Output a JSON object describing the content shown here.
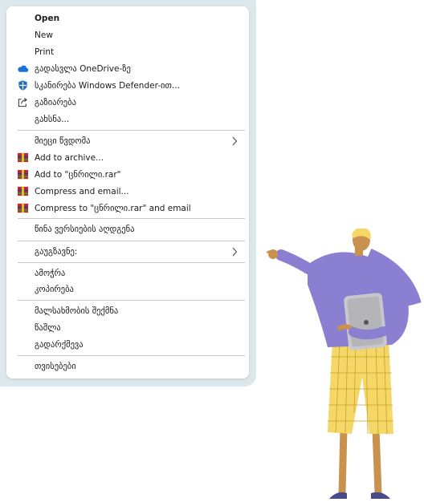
{
  "menu": {
    "items": [
      {
        "label": "Open"
      },
      {
        "label": "New"
      },
      {
        "label": "Print"
      },
      {
        "label": "გადასვლა OneDrive-ზე"
      },
      {
        "label": "სკანირება Windows Defender-ით..."
      },
      {
        "label": "გაზიარება"
      },
      {
        "label": "გახსნა..."
      },
      {
        "label": "მიეცი წვდომა"
      },
      {
        "label": "Add to archive..."
      },
      {
        "label": "Add to \"ცნრილი.rar\""
      },
      {
        "label": "Compress and email..."
      },
      {
        "label": "Compress to \"ცნრილი.rar\" and email"
      },
      {
        "label": "წინა ვერსიების აღდგენა"
      },
      {
        "label": "გაუგზავნე:"
      },
      {
        "label": "ამოჭრა"
      },
      {
        "label": "კოპირება"
      },
      {
        "label": "მალსახმობის შექმნა"
      },
      {
        "label": "წაშლა"
      },
      {
        "label": "გადარქმევა"
      },
      {
        "label": "თვისებები"
      }
    ]
  },
  "colors": {
    "frame_background": "#dde8ec",
    "onedrive_blue": "#1a73d9",
    "defender_blue": "#1f6fc5",
    "winrar_red": "#c4262e",
    "illustration_purple": "#8b7fd1",
    "illustration_yellow": "#f4d766"
  },
  "icons": {
    "onedrive": "cloud-icon",
    "defender": "shield-icon",
    "share": "share-icon",
    "archive": "winrar-icon",
    "submenu": "chevron-right-icon"
  }
}
